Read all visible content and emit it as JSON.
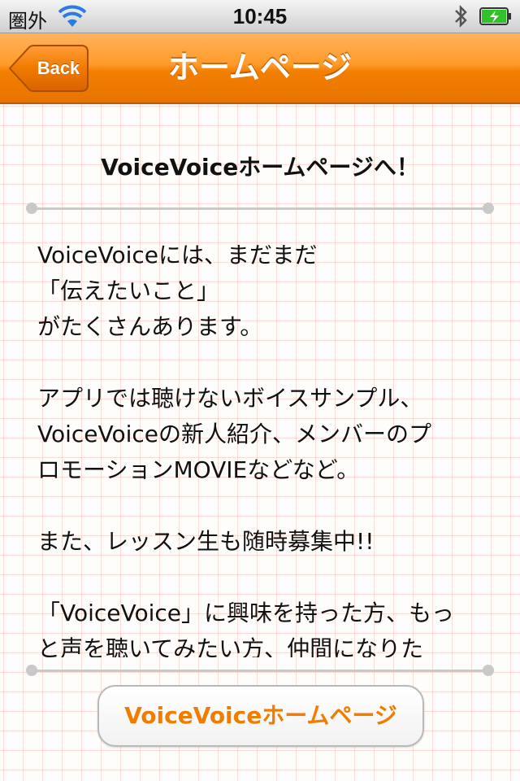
{
  "status_bar": {
    "carrier": "圏外",
    "time": "10:45",
    "icons": [
      "wifi-icon",
      "bluetooth-icon",
      "battery-charging-icon"
    ],
    "battery_color": "#31c22b"
  },
  "nav_bar": {
    "back_label": "Back",
    "title": "ホームページ",
    "accent_color": "#f27f00"
  },
  "content": {
    "heading": "VoiceVoiceホームページへ！",
    "body_lines": [
      "VoiceVoiceには、まだまだ",
      "「伝えたいこと」",
      "がたくさんあります。",
      "",
      "アプリでは聴けないボイスサンプル、",
      "VoiceVoiceの新人紹介、メンバーのプ",
      "ロモーションMOVIEなどなど。",
      "",
      "また、レッスン生も随時募集中!!",
      "",
      "「VoiceVoice」に興味を持った方、もっ",
      "と声を聴いてみたい方、仲間になりた"
    ],
    "button_label": "VoiceVoiceホームページ",
    "button_text_color": "#f07d00"
  }
}
